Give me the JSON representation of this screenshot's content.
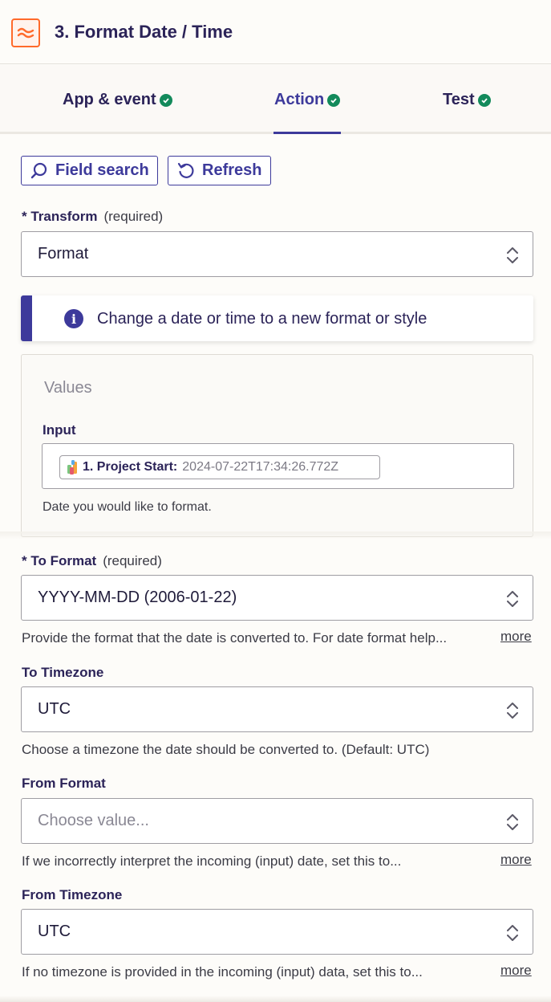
{
  "header": {
    "title": "3. Format Date / Time",
    "icon": "formatter-icon"
  },
  "tabs": [
    {
      "label": "App & event",
      "complete": true
    },
    {
      "label": "Action",
      "complete": true,
      "active": true
    },
    {
      "label": "Test",
      "complete": true
    }
  ],
  "toolbar": {
    "field_search_label": "Field search",
    "refresh_label": "Refresh"
  },
  "transform": {
    "label": "Transform",
    "required_text": "(required)",
    "value": "Format"
  },
  "info": {
    "text": "Change a date or time to a new format or style"
  },
  "values": {
    "title": "Values",
    "input_label": "Input",
    "pill_label": "1. Project Start:",
    "pill_value": "2024-07-22T17:34:26.772Z",
    "help": "Date you would like to format."
  },
  "to_format": {
    "label": "To Format",
    "required_text": "(required)",
    "value": "YYYY-MM-DD (2006-01-22)",
    "help": "Provide the format that the date is converted to. For date format help...",
    "more": "more"
  },
  "to_timezone": {
    "label": "To Timezone",
    "value": "UTC",
    "help": "Choose a timezone the date should be converted to. (Default: UTC)"
  },
  "from_format": {
    "label": "From Format",
    "placeholder": "Choose value...",
    "help": "If we incorrectly interpret the incoming (input) date, set this to...",
    "more": "more"
  },
  "from_timezone": {
    "label": "From Timezone",
    "value": "UTC",
    "help": "If no timezone is provided in the incoming (input) data, set this to...",
    "more": "more"
  },
  "colors": {
    "accent": "#3d3a9b",
    "success": "#138a5b",
    "brand": "#ff6a2b"
  }
}
